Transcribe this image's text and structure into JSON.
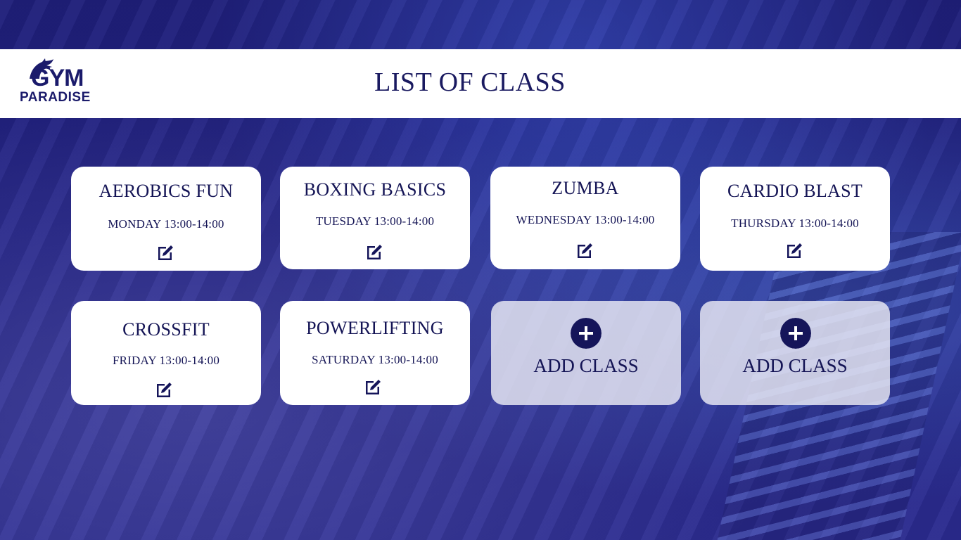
{
  "brand": {
    "logo_top": "GYM",
    "logo_bottom": "PARADISE"
  },
  "page": {
    "title": "LIST OF CLASS"
  },
  "classes": [
    {
      "name": "AEROBICS FUN",
      "schedule": "MONDAY 13:00-14:00"
    },
    {
      "name": "BOXING BASICS",
      "schedule": "TUESDAY 13:00-14:00"
    },
    {
      "name": "ZUMBA",
      "schedule": "WEDNESDAY 13:00-14:00"
    },
    {
      "name": "CARDIO BLAST",
      "schedule": "THURSDAY 13:00-14:00"
    },
    {
      "name": "CROSSFIT",
      "schedule": "FRIDAY 13:00-14:00"
    },
    {
      "name": "POWERLIFTING",
      "schedule": "SATURDAY 13:00-14:00"
    }
  ],
  "add_slots": [
    {
      "label": "ADD CLASS"
    },
    {
      "label": "ADD CLASS"
    }
  ],
  "icons": {
    "edit": "edit-icon",
    "add": "plus-circle-icon",
    "logo": "dragon-icon"
  },
  "colors": {
    "navy": "#15155a",
    "background": "#1f1f7a",
    "card": "#ffffff"
  }
}
